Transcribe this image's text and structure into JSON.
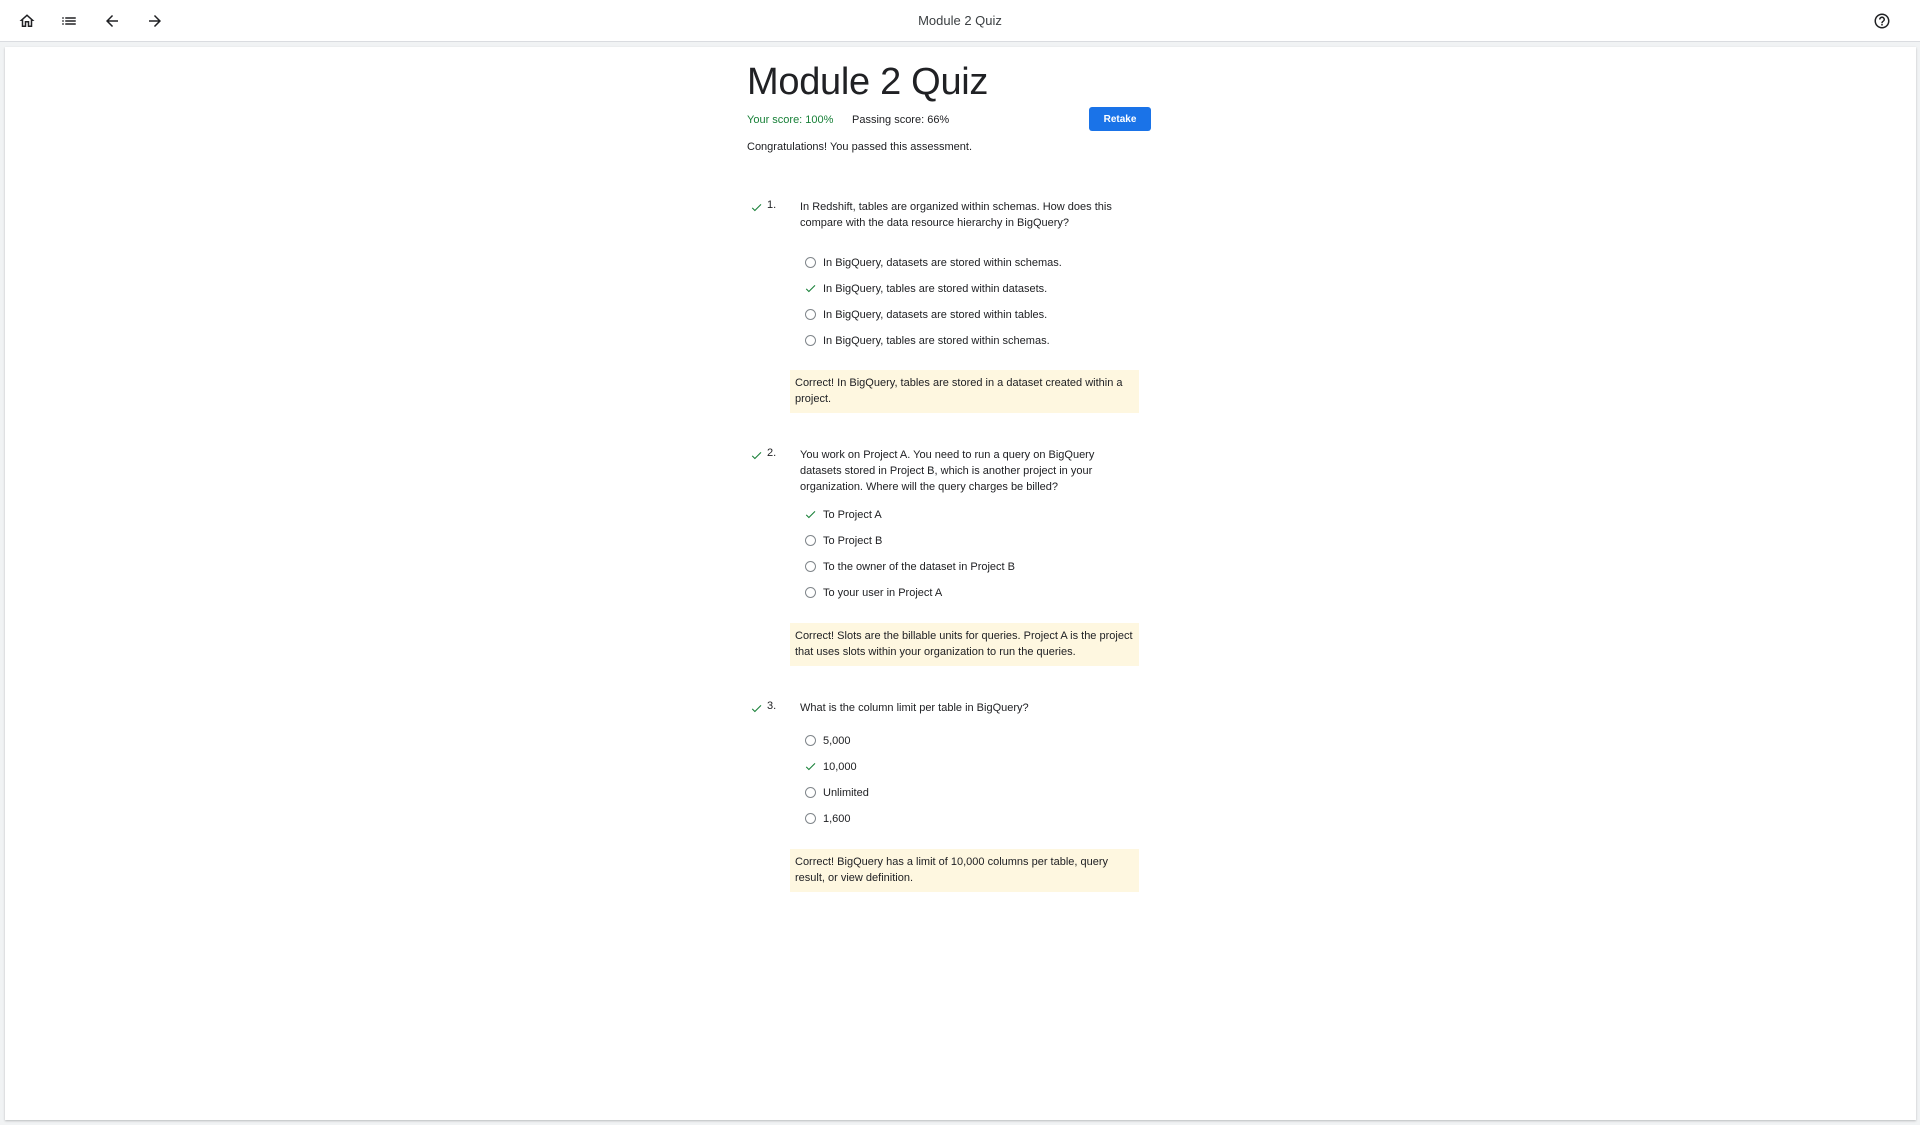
{
  "app": {
    "title": "Module 2 Quiz",
    "icons": [
      "home-icon",
      "list-icon",
      "arrow-back-icon",
      "arrow-forward-icon",
      "help-icon"
    ]
  },
  "quiz": {
    "title": "Module 2 Quiz",
    "score_text": "Your score: 100%",
    "passing_text": "Passing score: 66%",
    "retake_label": "Retake",
    "congrats_text": "Congratulations! You passed this assessment.",
    "accent_color": "#1a73e8",
    "correct_color": "#188038",
    "feedback_bg": "#fef7e0",
    "questions": [
      {
        "number": "1.",
        "text": "In Redshift, tables are organized within schemas. How does this compare with the data resource hierarchy in BigQuery?",
        "options": [
          {
            "label": "In BigQuery, datasets are stored within schemas.",
            "selected": false
          },
          {
            "label": "In BigQuery, tables are stored within datasets.",
            "selected": true
          },
          {
            "label": "In BigQuery, datasets are stored within tables.",
            "selected": false
          },
          {
            "label": "In BigQuery, tables are stored within schemas.",
            "selected": false
          }
        ],
        "feedback": "Correct! In BigQuery, tables are stored in a dataset created within a project."
      },
      {
        "number": "2.",
        "text": "You work on Project A. You need to run a query on BigQuery datasets stored in Project B, which is another project in your organization. Where will the query charges be billed?",
        "options": [
          {
            "label": "To Project A",
            "selected": true
          },
          {
            "label": "To Project B",
            "selected": false
          },
          {
            "label": "To the owner of the dataset in Project B",
            "selected": false
          },
          {
            "label": "To your user in Project A",
            "selected": false
          }
        ],
        "feedback": "Correct! Slots are the billable units for queries. Project A is the project that uses slots within your organization to run the queries."
      },
      {
        "number": "3.",
        "text": "What is the column limit per table in BigQuery?",
        "options": [
          {
            "label": "5,000",
            "selected": false
          },
          {
            "label": "10,000",
            "selected": true
          },
          {
            "label": "Unlimited",
            "selected": false
          },
          {
            "label": "1,600",
            "selected": false
          }
        ],
        "feedback": "Correct! BigQuery has a limit of 10,000 columns per table, query result, or view definition."
      }
    ]
  }
}
